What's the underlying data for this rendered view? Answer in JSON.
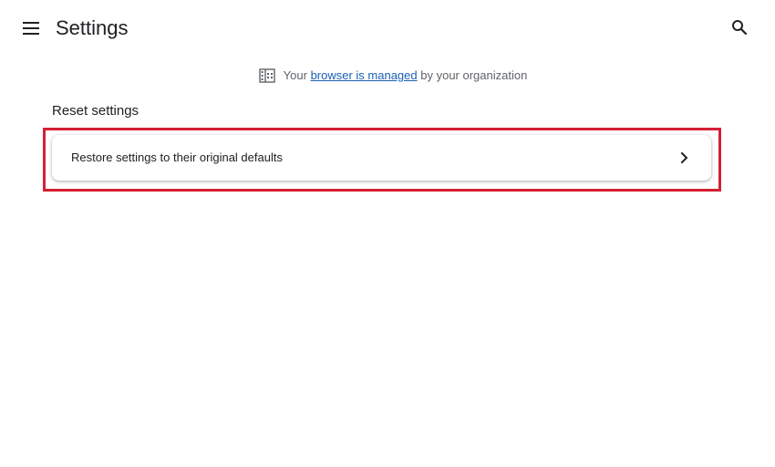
{
  "header": {
    "title": "Settings",
    "menu_icon": "hamburger-menu-icon",
    "search_icon": "search-icon"
  },
  "managed_notice": {
    "icon": "building-icon",
    "prefix": "Your",
    "link_text": "browser is managed",
    "suffix": "by your organization"
  },
  "reset_section": {
    "heading": "Reset settings",
    "items": [
      {
        "label": "Restore settings to their original defaults",
        "icon": "chevron-right-icon"
      }
    ]
  },
  "colors": {
    "highlight": "#d42033",
    "link": "#1a5fb4",
    "text": "#202124",
    "muted_text": "#5f6368"
  }
}
